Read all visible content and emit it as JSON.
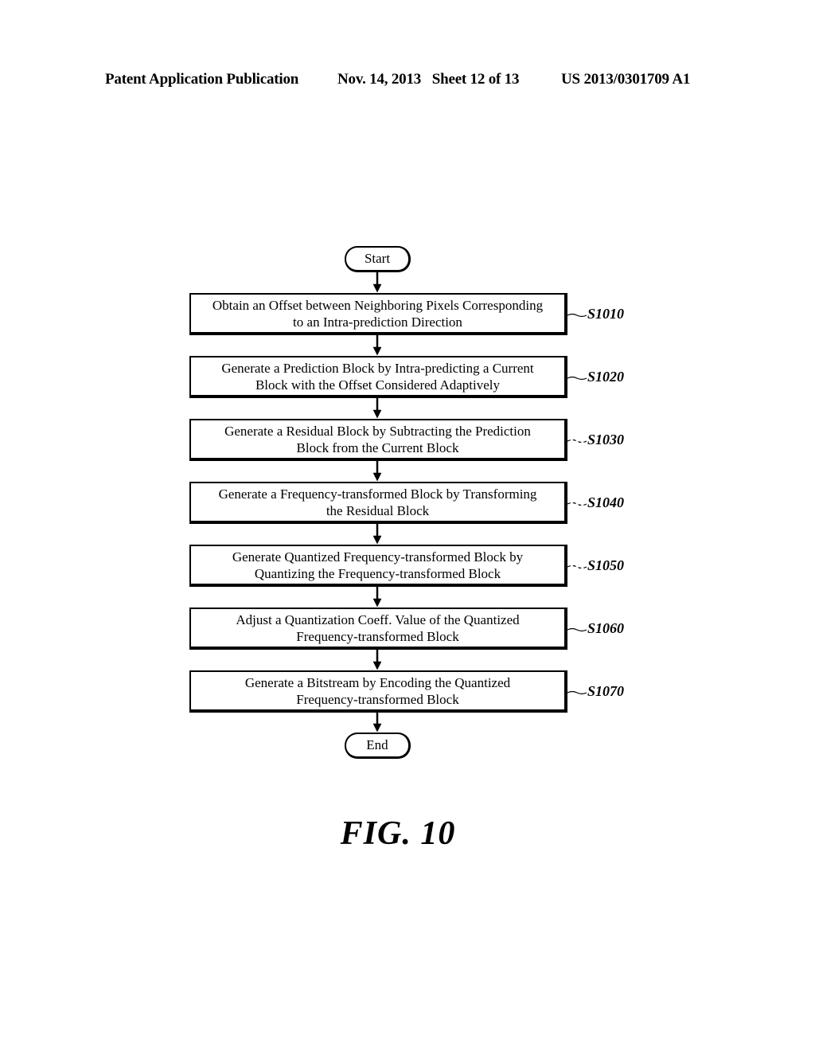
{
  "header": {
    "publication": "Patent Application Publication",
    "date_sheet": "Nov. 14, 2013   Sheet 12 of 13",
    "number": "US 2013/0301709 A1"
  },
  "flowchart": {
    "start_label": "Start",
    "end_label": "End",
    "steps": [
      {
        "id": "S1010",
        "line1": "Obtain an Offset between Neighboring Pixels Corresponding",
        "line2": "to an Intra-prediction Direction"
      },
      {
        "id": "S1020",
        "line1": "Generate a Prediction Block by Intra-predicting a Current",
        "line2": "Block with the Offset Considered Adaptively"
      },
      {
        "id": "S1030",
        "line1": "Generate a Residual Block by Subtracting the Prediction",
        "line2": "Block from the Current Block"
      },
      {
        "id": "S1040",
        "line1": "Generate a Frequency-transformed Block by Transforming",
        "line2": "the Residual Block"
      },
      {
        "id": "S1050",
        "line1": "Generate Quantized Frequency-transformed Block by",
        "line2": "Quantizing the Frequency-transformed Block"
      },
      {
        "id": "S1060",
        "line1": "Adjust a Quantization Coeff. Value of the Quantized",
        "line2": "Frequency-transformed Block"
      },
      {
        "id": "S1070",
        "line1": "Generate a Bitstream by Encoding the Quantized",
        "line2": "Frequency-transformed Block"
      }
    ]
  },
  "figure_label": "FIG. 10"
}
